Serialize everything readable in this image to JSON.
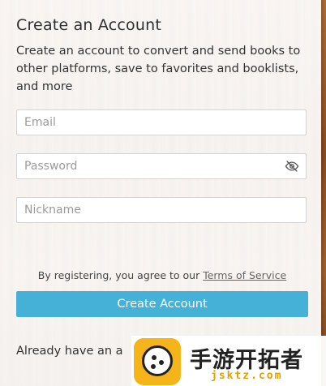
{
  "form": {
    "title": "Create an Account",
    "subtitle": "Create an account to convert and send books to other platforms, save to favorites and booklists, and more",
    "email_placeholder": "Email",
    "password_placeholder": "Password",
    "nickname_placeholder": "Nickname",
    "terms_prefix": "By registering, you agree to our ",
    "terms_link": "Terms of Service",
    "submit_label": "Create Account",
    "already_text": "Already have an a"
  },
  "watermark": {
    "text_cn": "手游开拓者",
    "url": "jsktz.com"
  },
  "colors": {
    "accent": "#45b1d6",
    "watermark_yellow": "#f4b41a"
  },
  "icons": {
    "password_toggle": "eye-slash-icon"
  }
}
